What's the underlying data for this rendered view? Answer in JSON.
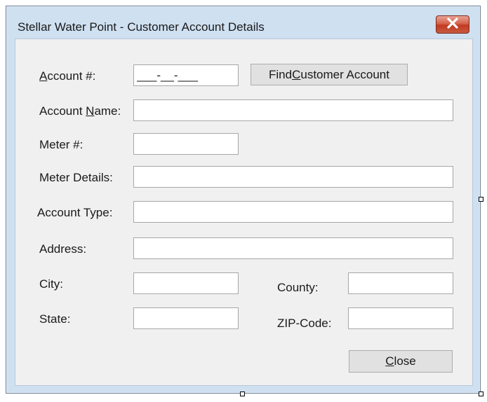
{
  "window": {
    "title": "Stellar Water Point - Customer Account Details",
    "close_icon": "close-icon"
  },
  "form": {
    "account_number": {
      "label_accel": "A",
      "label_rest": "ccount #:",
      "value": "___-__-___"
    },
    "find_button": {
      "label_pre": "Find ",
      "label_accel": "C",
      "label_post": "ustomer Account"
    },
    "account_name": {
      "label_pre": "Account ",
      "label_accel": "N",
      "label_post": "ame:",
      "value": ""
    },
    "meter_number": {
      "label": "Meter #:",
      "value": ""
    },
    "meter_details": {
      "label": "Meter Details:",
      "value": ""
    },
    "account_type": {
      "label": "Account Type:",
      "value": ""
    },
    "address": {
      "label": "Address:",
      "value": ""
    },
    "city": {
      "label": "City:",
      "value": ""
    },
    "county": {
      "label": "County:",
      "value": ""
    },
    "state": {
      "label": "State:",
      "value": ""
    },
    "zip_code": {
      "label": "ZIP-Code:",
      "value": ""
    },
    "close_button": {
      "label_accel": "C",
      "label_rest": "lose"
    }
  },
  "colors": {
    "frame": "#cfe0f1",
    "client": "#f0f0f0",
    "close_red": "#c23a22"
  }
}
